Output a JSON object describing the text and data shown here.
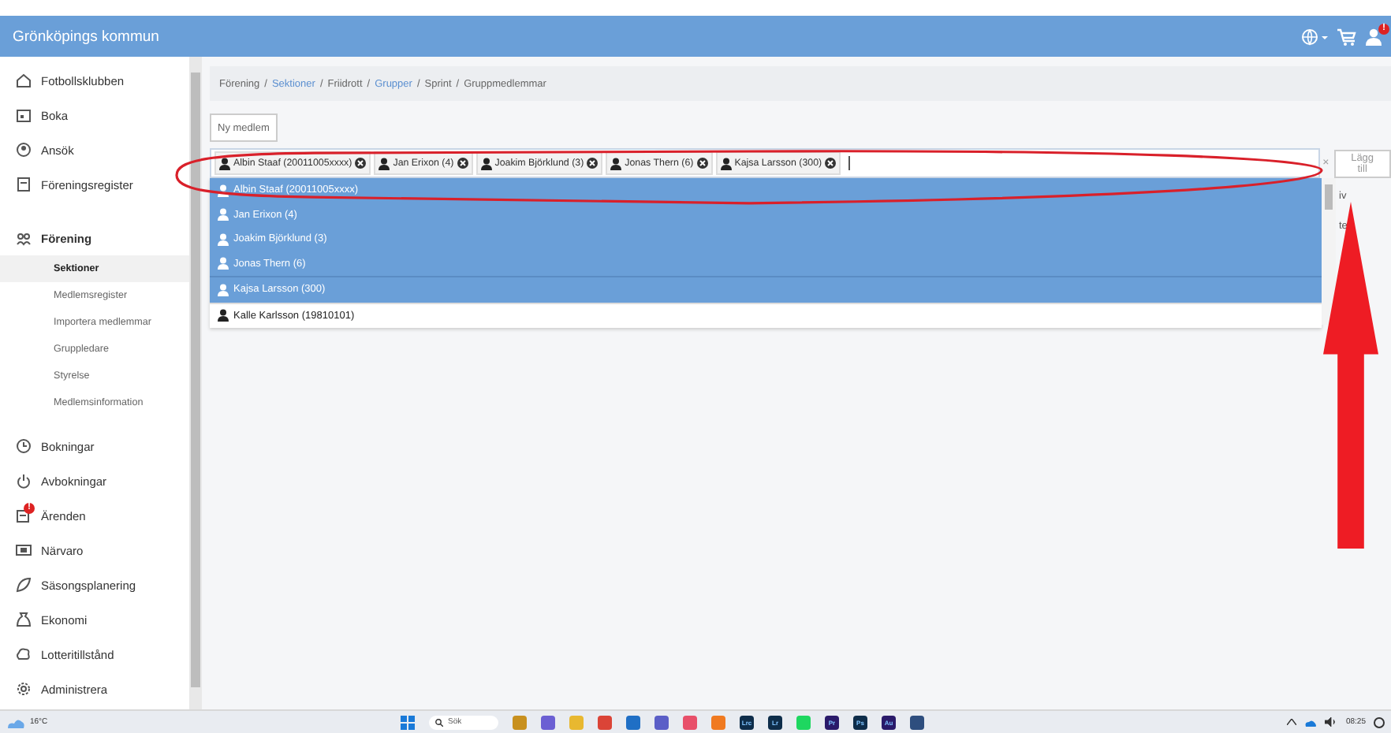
{
  "header": {
    "title": "Grönköpings kommun",
    "user_badge": "!"
  },
  "sidebar": {
    "items": [
      {
        "label": "Fotbollsklubben",
        "selected": false
      },
      {
        "label": "Boka",
        "selected": false
      },
      {
        "label": "Ansök",
        "selected": false
      },
      {
        "label": "Föreningsregister",
        "selected": false
      },
      {
        "label": "Förening",
        "selected": false,
        "expanded": true,
        "children": [
          {
            "label": "Sektioner",
            "selected": true
          },
          {
            "label": "Medlemsregister",
            "selected": false
          },
          {
            "label": "Importera medlemmar",
            "selected": false
          },
          {
            "label": "Gruppledare",
            "selected": false
          },
          {
            "label": "Styrelse",
            "selected": false
          },
          {
            "label": "Medlemsinformation",
            "selected": false
          }
        ]
      },
      {
        "label": "Bokningar",
        "selected": false
      },
      {
        "label": "Avbokningar",
        "selected": false
      },
      {
        "label": "Ärenden",
        "selected": false,
        "badge": "!"
      },
      {
        "label": "Närvaro",
        "selected": false
      },
      {
        "label": "Säsongsplanering",
        "selected": false
      },
      {
        "label": "Ekonomi",
        "selected": false
      },
      {
        "label": "Lotteritillstånd",
        "selected": false
      },
      {
        "label": "Administrera",
        "selected": false
      }
    ]
  },
  "breadcrumb": [
    {
      "label": "Förening",
      "kind": "text"
    },
    {
      "label": "/",
      "kind": "separator"
    },
    {
      "label": "Sektioner",
      "kind": "link"
    },
    {
      "label": "/",
      "kind": "separator"
    },
    {
      "label": "Friidrott",
      "kind": "text"
    },
    {
      "label": "/",
      "kind": "separator"
    },
    {
      "label": "Grupper",
      "kind": "link"
    },
    {
      "label": "/",
      "kind": "separator"
    },
    {
      "label": "Sprint",
      "kind": "text"
    },
    {
      "label": "/",
      "kind": "separator"
    },
    {
      "label": "Gruppmedlemmar",
      "kind": "text"
    }
  ],
  "new_member_button": "Ny medlem",
  "member_picker": {
    "tags": [
      "Albin Staaf (20011005xxxx)",
      "Jan Erixon (4)",
      "Joakim Björklund (3)",
      "Jonas Thern (6)",
      "Kajsa Larsson (300)"
    ],
    "clear": "×",
    "add_button": "Lägg till",
    "options": [
      {
        "label": "Albin Staaf (20011005xxxx)",
        "selected": true
      },
      {
        "label": "Jan Erixon (4)",
        "selected": true
      },
      {
        "label": "Joakim Björklund (3)",
        "selected": true
      },
      {
        "label": "Jonas Thern (6)",
        "selected": true
      },
      {
        "label": "Kajsa Larsson (300)",
        "selected": true
      },
      {
        "label": "Kalle Karlsson (19810101)",
        "selected": false
      }
    ]
  },
  "behind_dropdown": [
    "iv",
    "te"
  ],
  "annotations": [
    {
      "kind": "ellipse"
    },
    {
      "kind": "arrow"
    }
  ],
  "taskbar": {
    "weather": "16°C",
    "search": "Sök",
    "apps": [
      {
        "kind": "briefcase"
      },
      {
        "kind": "chat"
      },
      {
        "kind": "folder"
      },
      {
        "kind": "browser"
      },
      {
        "kind": "mail"
      },
      {
        "kind": "teams"
      },
      {
        "kind": "photos"
      },
      {
        "kind": "fox"
      },
      {
        "kind": "adobe",
        "label": "Lrc"
      },
      {
        "kind": "adobe",
        "label": "Lr"
      },
      {
        "kind": "music"
      },
      {
        "kind": "adobe-purple",
        "label": "Pr"
      },
      {
        "kind": "adobe",
        "label": "Ps"
      },
      {
        "kind": "adobe-purple",
        "label": "Au"
      },
      {
        "kind": "tool"
      }
    ],
    "time": "08:25"
  }
}
